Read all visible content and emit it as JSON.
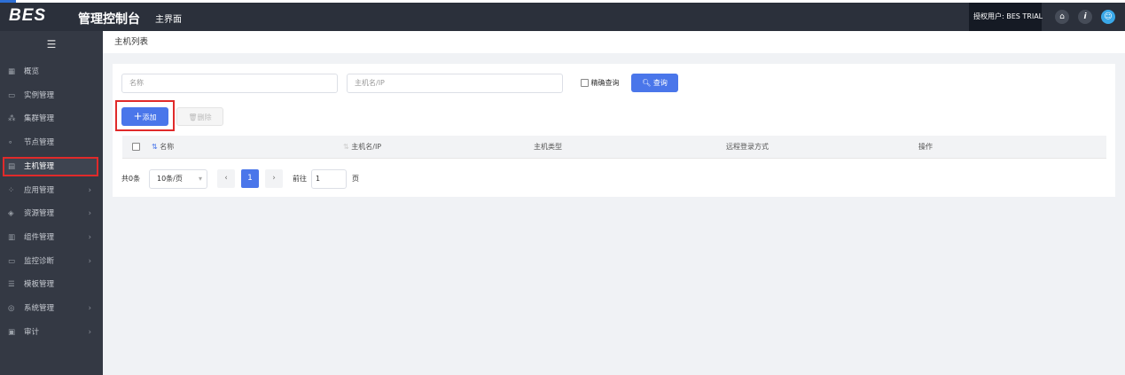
{
  "header": {
    "logo": "BES",
    "title": "管理控制台",
    "home_link": "主界面",
    "user_label": "授权用户: BES TRIAL"
  },
  "sidebar": {
    "items": [
      {
        "label": "概览",
        "icon": "grid-icon",
        "has_children": false
      },
      {
        "label": "实例管理",
        "icon": "window-icon",
        "has_children": false
      },
      {
        "label": "集群管理",
        "icon": "cluster-icon",
        "has_children": false
      },
      {
        "label": "节点管理",
        "icon": "node-icon",
        "has_children": false
      },
      {
        "label": "主机管理",
        "icon": "host-icon",
        "has_children": false,
        "active": true
      },
      {
        "label": "应用管理",
        "icon": "apps-icon",
        "has_children": true
      },
      {
        "label": "资源管理",
        "icon": "layers-icon",
        "has_children": true
      },
      {
        "label": "组件管理",
        "icon": "bars-icon",
        "has_children": true
      },
      {
        "label": "监控诊断",
        "icon": "monitor-icon",
        "has_children": true
      },
      {
        "label": "模板管理",
        "icon": "template-icon",
        "has_children": false
      },
      {
        "label": "系统管理",
        "icon": "settings-icon",
        "has_children": true
      },
      {
        "label": "审计",
        "icon": "audit-icon",
        "has_children": true
      }
    ]
  },
  "breadcrumb": "主机列表",
  "filters": {
    "name_placeholder": "名称",
    "host_placeholder": "主机名/IP",
    "exact_label": "精确查询",
    "query_label": "查询"
  },
  "actions": {
    "add_label": "添加",
    "delete_label": "删除"
  },
  "table": {
    "columns": [
      "名称",
      "主机名/IP",
      "主机类型",
      "远程登录方式",
      "操作"
    ]
  },
  "pagination": {
    "total": "共0条",
    "page_size": "10条/页",
    "current_page": "1",
    "goto_label": "前往",
    "goto_value": "1",
    "page_suffix": "页"
  }
}
